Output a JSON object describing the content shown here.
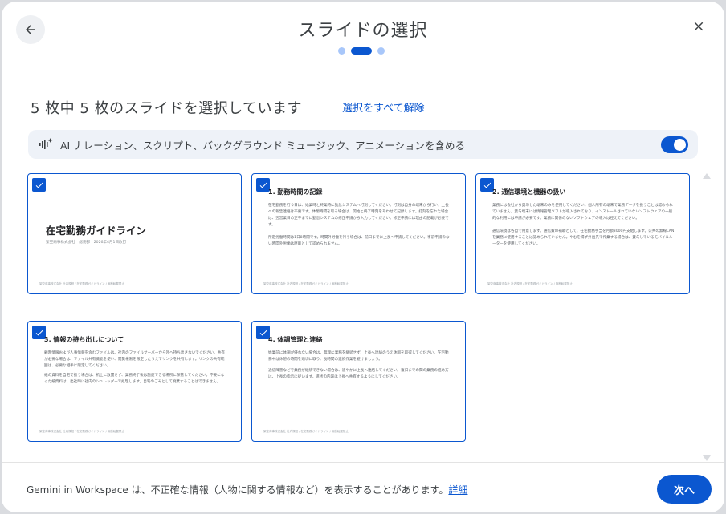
{
  "dialog": {
    "title": "スライドの選択",
    "steps": {
      "total": 3,
      "current": 2
    }
  },
  "selection": {
    "count_text": "5 枚中 5 枚のスライドを選択しています",
    "deselect_all": "選択をすべて解除"
  },
  "ai_option": {
    "label": "AI ナレーション、スクリプト、バックグラウンド ミュージック、アニメーションを含める",
    "enabled": true
  },
  "slides": [
    {
      "selected": true,
      "cover_title": "在宅勤務ガイドライン",
      "cover_subtitle": "架空商事株式会社　総務部　2026年4月1日改訂",
      "footer": "架空商事株式会社 社内規程 / 在宅勤務ガイドライン / 無断転載禁止"
    },
    {
      "selected": true,
      "heading": "1. 勤務時間の記録",
      "paragraphs": [
        "在宅勤務を行う日は、始業時と終業時に勤怠システムへ打刻してください。打刻は自身の端末から行い、上長への報告連絡は不要です。休憩時間を取る場合は、開始と終了時刻をあわせて記録します。打刻を忘れた場合は、翌営業日の正午までに勤怠システムの修正申請から入力してください。修正申請には理由の記載が必要です。",
        "所定労働時間は1日8時間です。時間外労働を行う場合は、前日までに上長へ申請してください。事前申請のない時間外労働は原則として認められません。"
      ],
      "footer": "架空商事株式会社 社内規程 / 在宅勤務ガイドライン / 無断転載禁止"
    },
    {
      "selected": true,
      "heading": "2. 通信環境と機器の扱い",
      "paragraphs": [
        "業務には会社から貸与した端末のみを使用してください。個人所有の端末で業務データを扱うことは認められていません。貸与端末には情報管理ソフトが導入されており、インストールされていないソフトウェアの一般的な利用には申請が必要です。業務に関係のないソフトウェアの導入は控えてください。",
        "通信環境は各自で用意します。通信費の補助として、在宅勤務手当を月額3000円支給します。公共の無線LANを業務に使用することは認められていません。やむを得ず外出先で作業する場合は、貸与しているモバイルルーターを使用してください。"
      ],
      "footer": "架空商事株式会社 社内規程 / 在宅勤務ガイドライン / 無断転載禁止"
    },
    {
      "selected": true,
      "heading": "3. 情報の持ち出しについて",
      "paragraphs": [
        "顧客情報および人事情報を含むファイルは、社内のファイルサーバーから外へ持ち出さないでください。共有が必要な場合は、ファイル共有機能を使い、閲覧権限を限定したうえでリンクを共有します。リンクの共有範囲は、必要な相手に限定してください。",
        "紙の資料を自宅で扱う場合は、机上に放置せず、業務終了後は施錠できる場所に保管してください。不要になった紙資料は、出社時に社内のシュレッダーで処理します。自宅のごみとして廃棄することはできません。"
      ],
      "footer": "架空商事株式会社 社内規程 / 在宅勤務ガイドライン / 無断転載禁止"
    },
    {
      "selected": true,
      "heading": "4. 体調管理と連絡",
      "paragraphs": [
        "始業前に体調が優れない場合は、無理に業務を継続せず、上長へ連絡のうえ休暇を取得してください。在宅勤務中は休憩の時間を適切に取り、長時間の連続作業を避けましょう。",
        "通信障害などで業務が継続できない場合は、速やかに上長へ連絡してください。復旧までの間の業務の進め方は、上長の指示に従います。進捗の内容は上長へ共有するようにしてください。"
      ],
      "footer": "架空商事株式会社 社内規程 / 在宅勤務ガイドライン / 無断転載禁止"
    }
  ],
  "footer": {
    "disclaimer": "Gemini in Workspace は、不正確な情報（人物に関する情報など）を表示することがあります。",
    "details_link": "詳細",
    "next_button": "次へ"
  },
  "colors": {
    "accent": "#0b57d0",
    "accent_light": "#a8c7fa",
    "ai_row_bg": "#eef2f8"
  },
  "icons": {
    "back": "arrow-left-icon",
    "close": "close-icon",
    "ai": "ai-sparkle-waveform-icon",
    "checkbox": "checkmark-icon"
  }
}
